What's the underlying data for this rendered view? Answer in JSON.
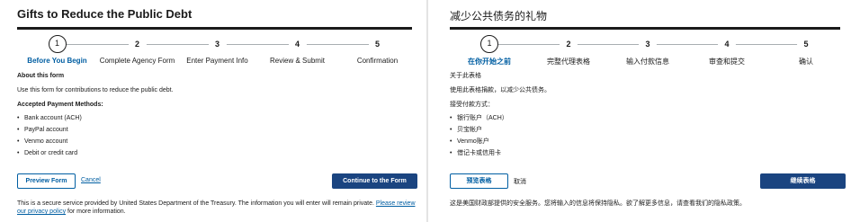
{
  "left": {
    "title": "Gifts to Reduce the Public Debt",
    "steps": [
      {
        "num": "1",
        "label": "Before You Begin"
      },
      {
        "num": "2",
        "label": "Complete Agency Form"
      },
      {
        "num": "3",
        "label": "Enter Payment Info"
      },
      {
        "num": "4",
        "label": "Review & Submit"
      },
      {
        "num": "5",
        "label": "Confirmation"
      }
    ],
    "about_heading": "About this form",
    "about_text": "Use this form for contributions to reduce the public debt.",
    "methods_heading": "Accepted Payment Methods:",
    "methods": [
      "Bank account (ACH)",
      "PayPal account",
      "Venmo account",
      "Debit or credit card"
    ],
    "preview_label": "Preview Form",
    "cancel_label": "Cancel",
    "continue_label": "Continue to the Form",
    "footer_text": "This is a secure service provided by United States Department of the Treasury. The information you will enter will remain private. ",
    "footer_link": "Please review our privacy policy",
    "footer_tail": " for more information."
  },
  "right": {
    "title": "减少公共债务的礼物",
    "steps": [
      {
        "num": "1",
        "label": "在你开始之前"
      },
      {
        "num": "2",
        "label": "完整代理表格"
      },
      {
        "num": "3",
        "label": "输入付款信息"
      },
      {
        "num": "4",
        "label": "审查和提交"
      },
      {
        "num": "5",
        "label": "确认"
      }
    ],
    "about_heading": "关于此表格",
    "about_text": "使用此表格捐款，以减少公共债务。",
    "methods_heading": "接受付款方式：",
    "methods": [
      "银行账户（ACH）",
      "贝宝帐户",
      "Venmo账户",
      "借记卡或信用卡"
    ],
    "preview_label": "预览表格",
    "cancel_label": "取消",
    "continue_label": "继续表格",
    "footer_text": "这是美国财政部提供的安全服务。您将输入的信息将保持隐私。欲了解更多信息，请查看我们的隐私政策。"
  }
}
